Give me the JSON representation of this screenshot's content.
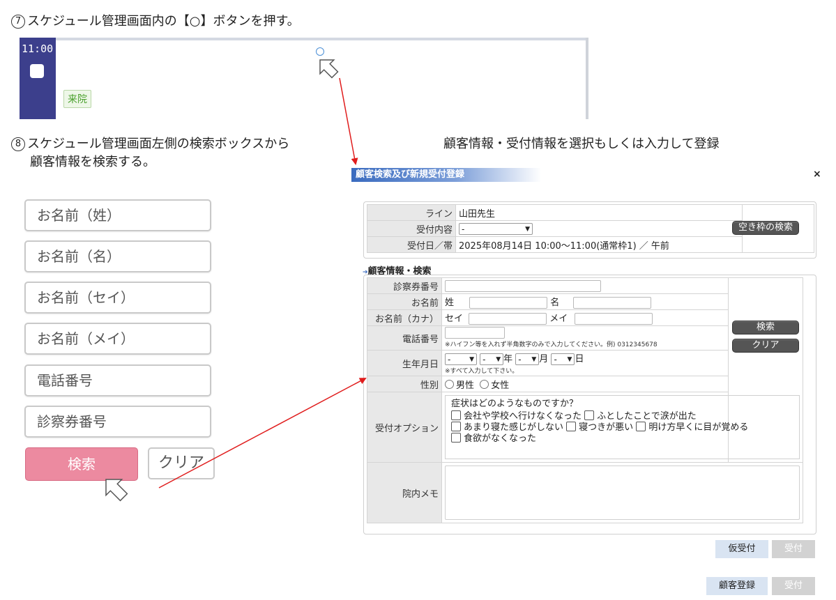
{
  "step7": {
    "number": "7",
    "text": "スケジュール管理画面内の【○】ボタンを押す。"
  },
  "step8": {
    "number": "8",
    "line1": "スケジュール管理画面左側の検索ボックスから",
    "line2": "顧客情報を検索する。"
  },
  "instruction_right": "顧客情報・受付情報を選択もしくは入力して登録",
  "schedule": {
    "time": "11:00",
    "badge": "来院"
  },
  "search_form": {
    "fields": [
      "お名前（姓）",
      "お名前（名）",
      "お名前（セイ）",
      "お名前（メイ）",
      "電話番号",
      "診察券番号"
    ],
    "search_button": "検索",
    "clear_button": "クリア"
  },
  "modal": {
    "title": "顧客検索及び新規受付登録",
    "close": "×",
    "reception": {
      "line_label": "ライン",
      "line_value": "山田先生",
      "content_label": "受付内容",
      "content_value": "-",
      "date_label": "受付日／帯",
      "date_value": "2025年08月14日 10:00〜11:00(通常枠1) ／ 午前",
      "empty_slot_button": "空き枠の検索"
    },
    "customer_section_title": "顧客情報・検索",
    "customer": {
      "card_label": "診察券番号",
      "name_label": "お名前",
      "sei": "姓",
      "mei": "名",
      "kana_label": "お名前（カナ）",
      "kana_sei": "セイ",
      "kana_mei": "メイ",
      "phone_label": "電話番号",
      "phone_note": "※ハイフン等を入れず半角数字のみで入力してください。例) 0312345678",
      "birth_label": "生年月日",
      "birth_select": "-",
      "year": "年",
      "month": "月",
      "day": "日",
      "birth_note": "※すべて入力して下さい。",
      "gender_label": "性別",
      "male": "男性",
      "female": "女性",
      "search_button": "検索",
      "clear_button": "クリア"
    },
    "options": {
      "label": "受付オプション",
      "question": "症状はどのようなものですか？",
      "items": [
        "会社や学校へ行けなくなった",
        "ふとしたことで涙が出た",
        "あまり寝た感じがしない",
        "寝つきが悪い",
        "明け方早くに目が覚める",
        "食欲がなくなった"
      ]
    },
    "memo_label": "院内メモ",
    "buttons": {
      "provisional": "仮受付",
      "accept": "受付",
      "register": "顧客登録",
      "accept2": "受付"
    }
  }
}
